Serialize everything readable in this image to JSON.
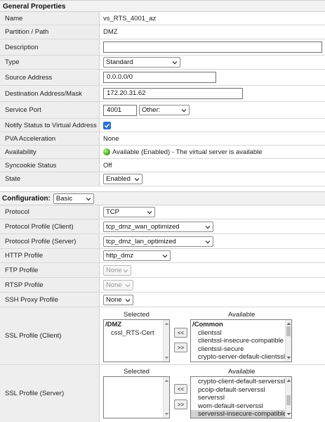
{
  "general": {
    "header": "General Properties",
    "name": {
      "label": "Name",
      "value": "vs_RTS_4001_az"
    },
    "partition": {
      "label": "Partition / Path",
      "value": "DMZ"
    },
    "description": {
      "label": "Description",
      "value": ""
    },
    "type": {
      "label": "Type",
      "value": "Standard"
    },
    "source": {
      "label": "Source Address",
      "value": "0.0.0.0/0"
    },
    "destination": {
      "label": "Destination Address/Mask",
      "value": "172.20.31.62"
    },
    "service_port": {
      "label": "Service Port",
      "value": "4001",
      "select": "Other:"
    },
    "notify": {
      "label": "Notify Status to Virtual Address",
      "checked": true
    },
    "pva": {
      "label": "PVA Acceleration",
      "value": "None"
    },
    "availability": {
      "label": "Availability",
      "status": "Available (Enabled)",
      "message": " - The virtual server is available",
      "status_color": "#3aa017"
    },
    "syncookie": {
      "label": "Syncookie Status",
      "value": "Off"
    },
    "state": {
      "label": "State",
      "value": "Enabled"
    }
  },
  "configuration": {
    "header": "Configuration:",
    "mode": "Basic",
    "protocol": {
      "label": "Protocol",
      "value": "TCP"
    },
    "profile_client": {
      "label": "Protocol Profile (Client)",
      "value": "tcp_dmz_wan_optimized"
    },
    "profile_server": {
      "label": "Protocol Profile (Server)",
      "value": "tcp_dmz_lan_optimized"
    },
    "http": {
      "label": "HTTP Profile",
      "value": "http_dmz"
    },
    "ftp": {
      "label": "FTP Profile",
      "value": "None"
    },
    "rtsp": {
      "label": "RTSP Profile",
      "value": "None"
    },
    "ssh": {
      "label": "SSH Proxy Profile",
      "value": "None"
    },
    "ssl_client": {
      "label": "SSL Profile (Client)",
      "selected_header": "Selected",
      "available_header": "Available",
      "selected_group": "/DMZ",
      "selected_items": [
        "cssl_RTS-Cert"
      ],
      "available_group": "/Common",
      "available_items": [
        "clientssl",
        "clientssl-insecure-compatible",
        "clientssl-secure",
        "crypto-server-default-clientssl"
      ],
      "btn_add": "<<",
      "btn_remove": ">>"
    },
    "ssl_server": {
      "label": "SSL Profile (Server)",
      "selected_header": "Selected",
      "available_header": "Available",
      "available_items": [
        "crypto-client-default-serverssl",
        "pcoip-default-serverssl",
        "serverssl",
        "wom-default-serverssl",
        "serverssl-insecure-compatible"
      ],
      "btn_add": "<<",
      "btn_remove": ">>"
    }
  }
}
